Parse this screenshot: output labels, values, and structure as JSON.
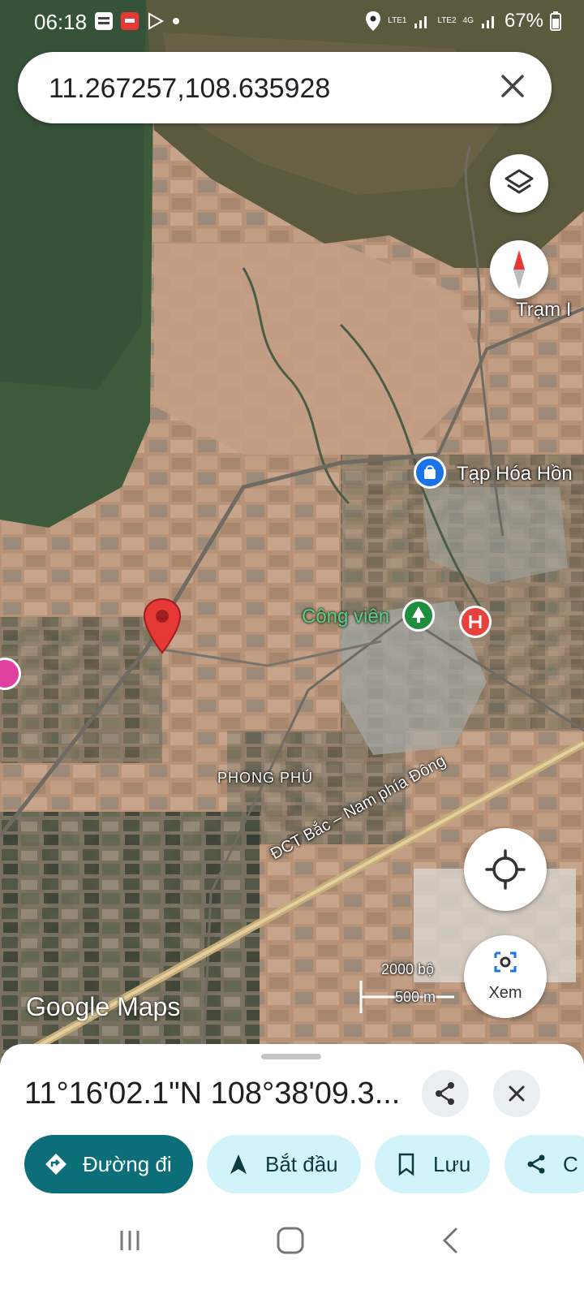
{
  "status_bar": {
    "time": "06:18",
    "app_icons": [
      "baomoi-icon",
      "pdf-icon",
      "play-store-icon"
    ],
    "sim1": "LTE1",
    "sim2": "LTE2",
    "network": "4G",
    "battery": "67%"
  },
  "search": {
    "query": "11.267257,108.635928"
  },
  "map": {
    "type": "satellite",
    "places": {
      "tram": "Trạm I",
      "tap_hoa": "Tạp Hóa Hồn",
      "cong_vien": "Công viên",
      "phong_phu": "PHONG PHÚ",
      "road": "ĐCT Bắc – Nam phía Đông"
    },
    "scale": {
      "imperial": "2000 bộ",
      "metric": "500 m"
    },
    "watermark": "Google Maps",
    "view_label": "Xem"
  },
  "sheet": {
    "coordinates": "11°16'02.1\"N 108°38'09.3...",
    "actions": {
      "directions": "Đường đi",
      "start": "Bắt đầu",
      "save": "Lưu",
      "share_partial": "C"
    }
  },
  "colors": {
    "directions_bg": "#0b6e78",
    "chip_bg": "#d3f3fb",
    "pin": "#e53935",
    "poi_blue": "#1a73e8",
    "poi_green": "#1e8e3e",
    "poi_red": "#e8403d"
  }
}
